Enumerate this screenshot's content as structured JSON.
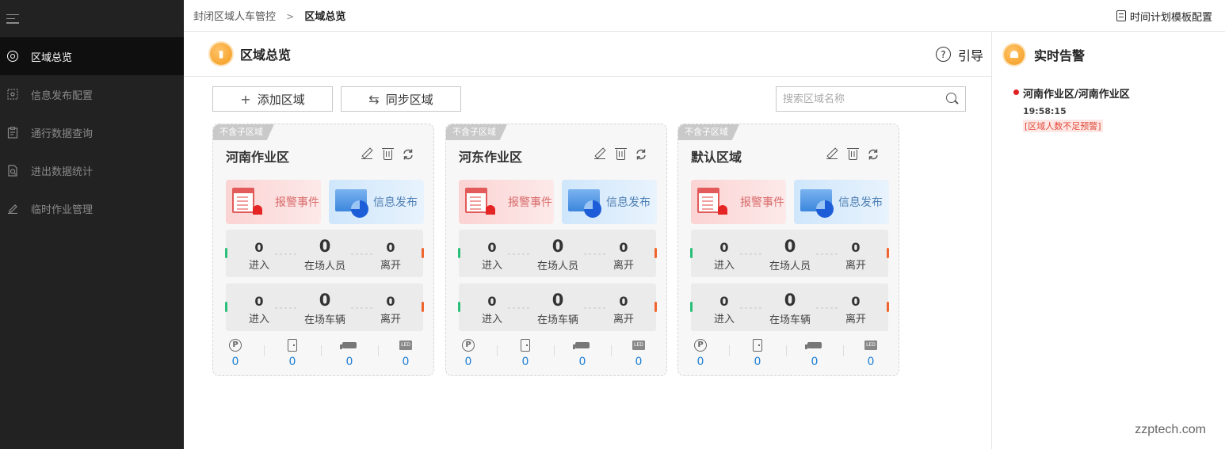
{
  "sidebar": {
    "items": [
      {
        "label": "区域总览",
        "icon": "target-icon",
        "active": true
      },
      {
        "label": "信息发布配置",
        "icon": "config-icon",
        "active": false
      },
      {
        "label": "通行数据查询",
        "icon": "clipboard-icon",
        "active": false
      },
      {
        "label": "进出数据统计",
        "icon": "stats-doc-icon",
        "active": false
      },
      {
        "label": "临时作业管理",
        "icon": "pencil-icon",
        "active": false
      }
    ]
  },
  "breadcrumb": {
    "parent": "封闭区域人车管控",
    "separator": ">",
    "current": "区域总览"
  },
  "topbar": {
    "template_config": "时间计划模板配置"
  },
  "main": {
    "title": "区域总览",
    "guide": "引导",
    "help_glyph": "?",
    "add_button": "添加区域",
    "add_glyph": "+",
    "sync_button": "同步区域",
    "sync_glyph": "⇆",
    "search_placeholder": "搜索区域名称"
  },
  "cards": [
    {
      "tag": "不含子区域",
      "title": "河南作业区",
      "alarm_label": "报警事件",
      "info_label": "信息发布",
      "people": {
        "in": "0",
        "present": "0",
        "out": "0",
        "in_label": "进入",
        "present_label": "在场人员",
        "out_label": "离开"
      },
      "vehicles": {
        "in": "0",
        "present": "0",
        "out": "0",
        "in_label": "进入",
        "present_label": "在场车辆",
        "out_label": "离开"
      },
      "devices": {
        "parking": "0",
        "door": "0",
        "camera": "0",
        "led": "0"
      }
    },
    {
      "tag": "不含子区域",
      "title": "河东作业区",
      "alarm_label": "报警事件",
      "info_label": "信息发布",
      "people": {
        "in": "0",
        "present": "0",
        "out": "0",
        "in_label": "进入",
        "present_label": "在场人员",
        "out_label": "离开"
      },
      "vehicles": {
        "in": "0",
        "present": "0",
        "out": "0",
        "in_label": "进入",
        "present_label": "在场车辆",
        "out_label": "离开"
      },
      "devices": {
        "parking": "0",
        "door": "0",
        "camera": "0",
        "led": "0"
      }
    },
    {
      "tag": "不含子区域",
      "title": "默认区域",
      "alarm_label": "报警事件",
      "info_label": "信息发布",
      "people": {
        "in": "0",
        "present": "0",
        "out": "0",
        "in_label": "进入",
        "present_label": "在场人员",
        "out_label": "离开"
      },
      "vehicles": {
        "in": "0",
        "present": "0",
        "out": "0",
        "in_label": "进入",
        "present_label": "在场车辆",
        "out_label": "离开"
      },
      "devices": {
        "parking": "0",
        "door": "0",
        "camera": "0",
        "led": "0"
      }
    }
  ],
  "device_icon_labels": {
    "parking": "P",
    "led": "LED"
  },
  "alerts_panel": {
    "title": "实时告警",
    "alerts": [
      {
        "location": "河南作业区/河南作业区",
        "time": "19:58:15",
        "type": "[区域人数不足预警]"
      }
    ]
  },
  "colors": {
    "accent_orange": "#f39a1c",
    "alert_red": "#e02020",
    "link_blue": "#1f7fd6",
    "sidebar_bg": "#222222"
  },
  "watermark": "zzptech.com"
}
